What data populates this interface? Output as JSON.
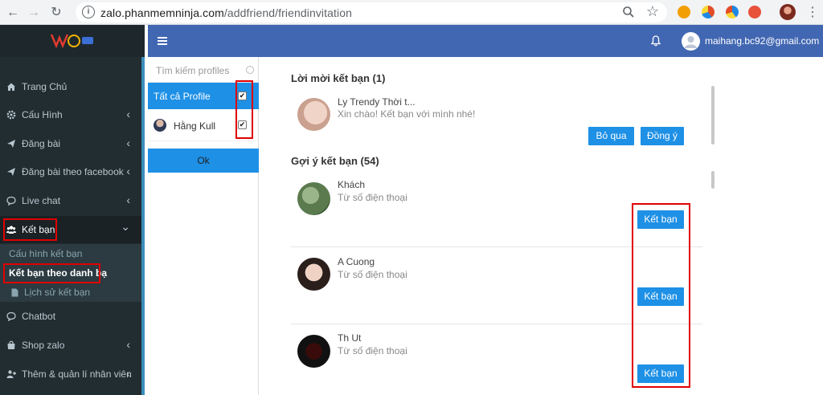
{
  "browser": {
    "url_host": "zalo.phanmemninja.com",
    "url_path": "/addfriend/friendinvitation",
    "back_icon": "←",
    "forward_icon": "→",
    "reload_icon": "↻",
    "star_icon": "☆",
    "menu_icon": "⋮"
  },
  "sidebar": {
    "brand_color": "#3c8dbc",
    "items": [
      {
        "label": "Trang Chủ",
        "icon": "home-icon",
        "chevron": ""
      },
      {
        "label": "Cấu Hình",
        "icon": "gear-icon",
        "chevron": "‹"
      },
      {
        "label": "Đăng bài",
        "icon": "send-icon",
        "chevron": "‹"
      },
      {
        "label": "Đăng bài theo facebook",
        "icon": "send-icon",
        "chevron": "‹"
      },
      {
        "label": "Live chat",
        "icon": "chat-icon",
        "chevron": "‹"
      },
      {
        "label": "Kết bạn",
        "icon": "users-icon",
        "chevron": "⌄"
      },
      {
        "label": "Chatbot",
        "icon": "chat-icon",
        "chevron": ""
      },
      {
        "label": "Shop zalo",
        "icon": "shopping-bag-icon",
        "chevron": "‹"
      },
      {
        "label": "Thêm & quản lí nhân viên",
        "icon": "add-user-icon",
        "chevron": "‹"
      }
    ],
    "submenu": [
      {
        "label": "Cấu hình kết bạn"
      },
      {
        "label": "Kết bạn theo danh bạ"
      },
      {
        "label": "Lịch sử kết bạn"
      }
    ]
  },
  "topbar": {
    "email": "maihang.bc92@gmail.com"
  },
  "profiles": {
    "search_placeholder": "Tìm kiếm profiles",
    "all_label": "Tất cả Profile",
    "items": [
      {
        "name": "Hằng Kull",
        "checked": true
      }
    ],
    "ok_label": "Ok"
  },
  "invitations": {
    "title": "Lời mời kết bạn (1)",
    "items": [
      {
        "name": "Ly Trendy Thời t...",
        "message": "Xin chào! Kết bạn với mình nhé!",
        "reject_label": "Bỏ qua",
        "accept_label": "Đồng ý"
      }
    ]
  },
  "suggestions": {
    "title": "Gợi ý kết bạn (54)",
    "items": [
      {
        "name": "Khách",
        "source": "Từ số điện thoại",
        "add_label": "Kết bạn"
      },
      {
        "name": "A Cuong",
        "source": "Từ số điện thoại",
        "add_label": "Kết bạn"
      },
      {
        "name": "Th Ut",
        "source": "Từ số điện thoại",
        "add_label": "Kết bạn"
      }
    ]
  },
  "colors": {
    "accent": "#1e90e6",
    "topbar": "#4267b2",
    "sidebar": "#222d32",
    "highlight_box": "#e00000"
  }
}
